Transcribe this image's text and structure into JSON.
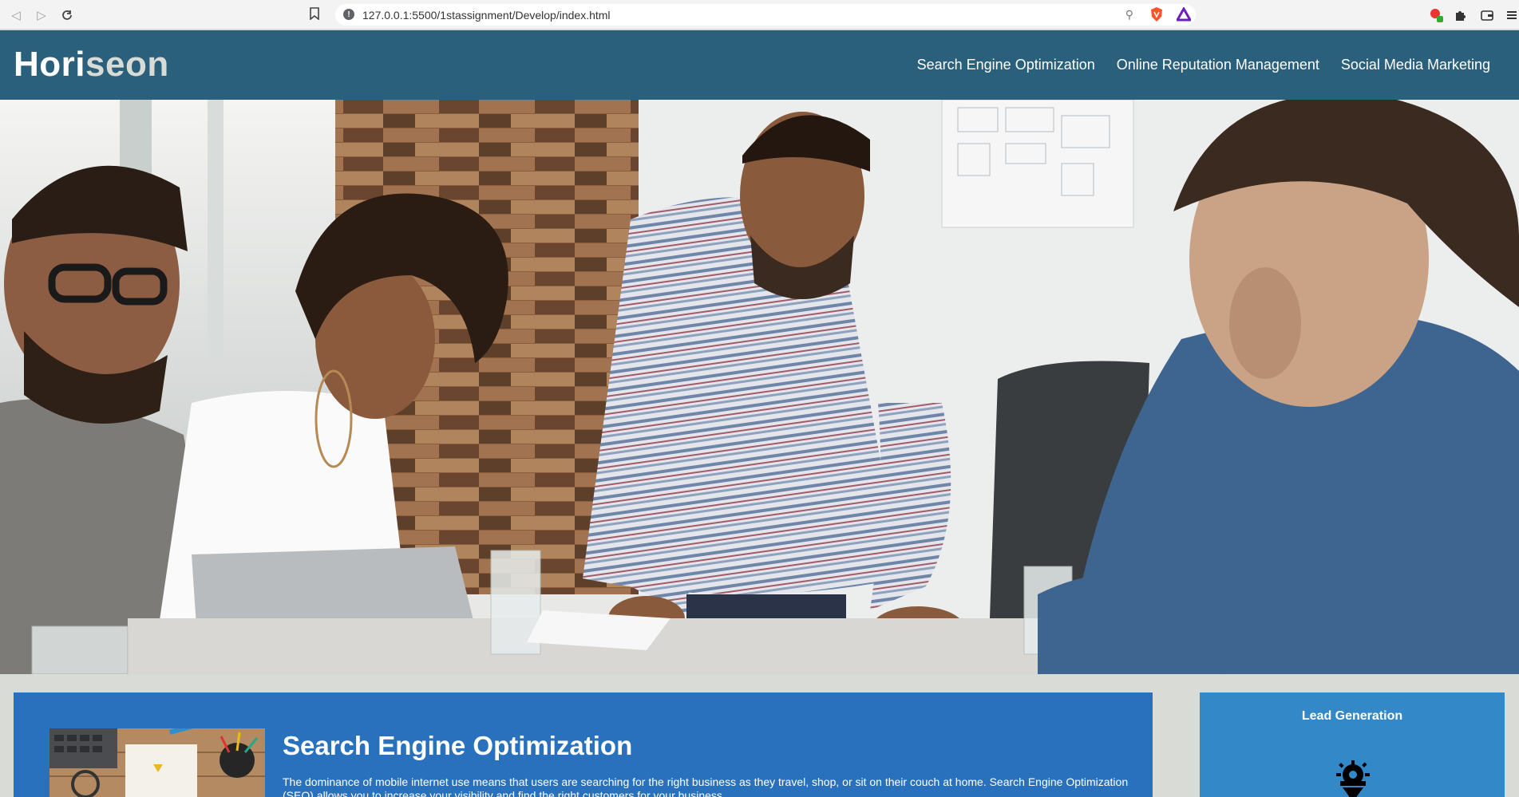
{
  "browser": {
    "url": "127.0.0.1:5500/1stassignment/Develop/index.html",
    "back_icon": "back-arrow-icon",
    "forward_icon": "forward-arrow-icon",
    "reload_icon": "reload-icon",
    "bookmark_icon": "bookmark-icon",
    "info_icon": "info-icon",
    "zoom_icon": "zoom-icon"
  },
  "header": {
    "logo_main": "Hori",
    "logo_accent": "seon",
    "nav": [
      "Search Engine Optimization",
      "Online Reputation Management",
      "Social Media Marketing"
    ]
  },
  "content": {
    "seo": {
      "title": "Search Engine Optimization",
      "text": "The dominance of mobile internet use means that users are searching for the right business as they travel, shop, or sit on their couch at home. Search Engine Optimization (SEO) allows you to increase your visibility and find the right customers for your business."
    },
    "sidebar": {
      "lead_title": "Lead Generation"
    }
  },
  "colors": {
    "header_bg": "#2a607c",
    "page_bg": "#d9dcd6",
    "seo_bg": "#2a71bd",
    "lead_bg": "#3389c7"
  }
}
